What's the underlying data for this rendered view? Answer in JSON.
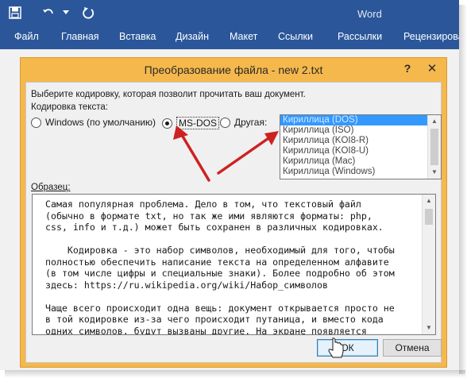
{
  "app": {
    "title": "Word",
    "tabs": [
      "Файл",
      "Главная",
      "Вставка",
      "Дизайн",
      "Макет",
      "Ссылки",
      "Рассылки",
      "Рецензирова"
    ]
  },
  "colors": {
    "ribbon": "#2b579a",
    "dialog_frame": "#f5b84c",
    "selection": "#3399ff",
    "annotation_arrow": "#cc2222"
  },
  "dialog": {
    "title": "Преобразование файла - new 2.txt",
    "help_label": "?",
    "close_label": "✕",
    "instruction": "Выберите кодировку, которая позволит прочитать ваш документ.",
    "encoding_label": "Кодировка текста:",
    "radios": [
      {
        "label": "Windows (по умолчанию)",
        "checked": false
      },
      {
        "label": "MS-DOS",
        "checked": true
      },
      {
        "label": "Другая:",
        "checked": false
      }
    ],
    "encodings": [
      "Кириллица (DOS)",
      "Кириллица (ISO)",
      "Кириллица (KOI8-R)",
      "Кириллица (KOI8-U)",
      "Кириллица (Mac)",
      "Кириллица (Windows)"
    ],
    "selected_encoding": "Кириллица (DOS)",
    "sample_label": "Образец:",
    "sample_lines": [
      "Самая популярная проблема. Дело в том, что текстовый файл",
      "(обычно в формате txt, но так же ими являются форматы: php,",
      "css, info и т.д.) может быть сохранен в различных кодировках.",
      "",
      "    Кодировка - это набор символов, необходимый для того, чтобы",
      "полностью обеспечить написание текста на определенном алфавите",
      "(в том числе цифры и специальные знаки). Более подробно об этом",
      "здесь: https://ru.wikipedia.org/wiki/Набор_символов",
      "",
      "Чаще всего происходит одна вещь: документ открывается просто не",
      "в той кодировке из-за чего происходит путаница, и вместо кода",
      "одних символов, будут вызваны другие. На экране появляется"
    ],
    "ok_label": "ОК",
    "cancel_label": "Отмена"
  }
}
